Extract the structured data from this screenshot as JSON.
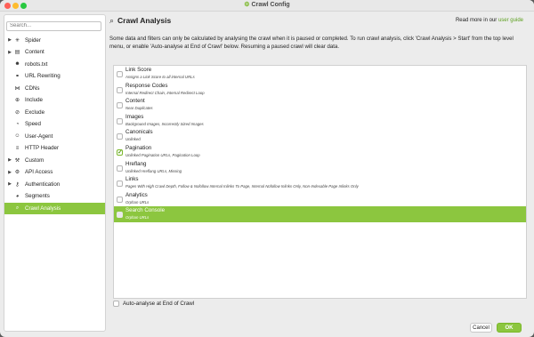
{
  "window": {
    "title": "Crawl Config",
    "title_icon": "gear-icon"
  },
  "sidebar": {
    "search_placeholder": "Search...",
    "items": [
      {
        "label": "Spider",
        "icon": "spider-icon",
        "expandable": true,
        "indent": false,
        "active": false
      },
      {
        "label": "Content",
        "icon": "document-icon",
        "expandable": true,
        "indent": false,
        "active": false
      },
      {
        "label": "robots.txt",
        "icon": "robot-icon",
        "expandable": false,
        "indent": true,
        "active": false
      },
      {
        "label": "URL Rewriting",
        "icon": "link-icon",
        "expandable": false,
        "indent": true,
        "active": false
      },
      {
        "label": "CDNs",
        "icon": "network-icon",
        "expandable": false,
        "indent": true,
        "active": false
      },
      {
        "label": "Include",
        "icon": "include-icon",
        "expandable": false,
        "indent": true,
        "active": false
      },
      {
        "label": "Exclude",
        "icon": "exclude-icon",
        "expandable": false,
        "indent": true,
        "active": false
      },
      {
        "label": "Speed",
        "icon": "speedometer-icon",
        "expandable": false,
        "indent": true,
        "active": false
      },
      {
        "label": "User-Agent",
        "icon": "user-icon",
        "expandable": false,
        "indent": true,
        "active": false
      },
      {
        "label": "HTTP Header",
        "icon": "header-icon",
        "expandable": false,
        "indent": true,
        "active": false
      },
      {
        "label": "Custom",
        "icon": "wrench-icon",
        "expandable": true,
        "indent": false,
        "active": false
      },
      {
        "label": "API Access",
        "icon": "gear-icon",
        "expandable": true,
        "indent": false,
        "active": false
      },
      {
        "label": "Authentication",
        "icon": "key-icon",
        "expandable": true,
        "indent": false,
        "active": false
      },
      {
        "label": "Segments",
        "icon": "pie-icon",
        "expandable": false,
        "indent": true,
        "active": false
      },
      {
        "label": "Crawl Analysis",
        "icon": "search-icon",
        "expandable": false,
        "indent": true,
        "active": true
      }
    ]
  },
  "main": {
    "title": "Crawl Analysis",
    "read_more_prefix": "Read more in our",
    "read_more_link": "user guide",
    "description": "Some data and filters can only be calculated by analysing the crawl when it is paused or completed. To run crawl analysis, click 'Crawl Analysis > Start' from the top level menu, or enable 'Auto-analyse at End of Crawl' below. Resuming a paused crawl will clear data.",
    "options": [
      {
        "title": "Link Score",
        "sub": "Assigns a Link Score to all internal URLs",
        "checked": false,
        "selected": false
      },
      {
        "title": "Response Codes",
        "sub": "Internal Redirect Chain, Internal Redirect Loop",
        "checked": false,
        "selected": false
      },
      {
        "title": "Content",
        "sub": "Near Duplicates",
        "checked": false,
        "selected": false
      },
      {
        "title": "Images",
        "sub": "Background Images, Incorrectly Sized Images",
        "checked": false,
        "selected": false
      },
      {
        "title": "Canonicals",
        "sub": "Unlinked",
        "checked": false,
        "selected": false
      },
      {
        "title": "Pagination",
        "sub": "Unlinked Pagination URLs, Pagination Loop",
        "checked": true,
        "selected": false
      },
      {
        "title": "Hreflang",
        "sub": "Unlinked Hreflang URLs, Missing",
        "checked": false,
        "selected": false
      },
      {
        "title": "Links",
        "sub": "Pages With High Crawl Depth, Follow & Nofollow Internal Inlinks To Page, Internal Nofollow Inlinks Only, Non-Indexable Page Inlinks Only",
        "checked": false,
        "selected": false
      },
      {
        "title": "Analytics",
        "sub": "Orphan URLs",
        "checked": false,
        "selected": false
      },
      {
        "title": "Search Console",
        "sub": "Orphan URLs",
        "checked": false,
        "selected": true
      }
    ],
    "auto_analyse_label": "Auto-analyse at End of Crawl",
    "auto_analyse_checked": false
  },
  "footer": {
    "cancel_label": "Cancel",
    "ok_label": "OK"
  },
  "colors": {
    "accent": "#8cc63f",
    "link": "#5a9e1c"
  }
}
